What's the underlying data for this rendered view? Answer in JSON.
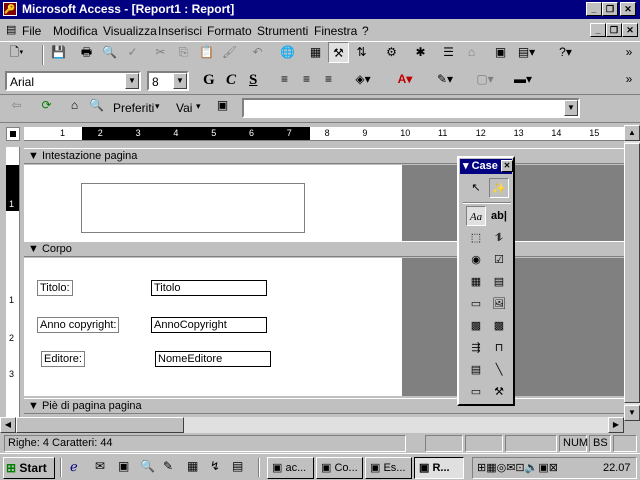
{
  "window": {
    "title": "Microsoft Access - [Report1 : Report]"
  },
  "menu": [
    "File",
    "Modifica",
    "Visualizza",
    "Inserisci",
    "Formato",
    "Strumenti",
    "Finestra",
    "?"
  ],
  "format": {
    "font": "Arial",
    "size": "8",
    "bold": "G",
    "italic": "C",
    "underline": "S"
  },
  "web": {
    "favorites": "Preferiti",
    "go": "Vai",
    "address": ""
  },
  "report": {
    "header_section": "Intestazione pagina",
    "body_section": "Corpo",
    "footer_section": "Piè di pagina pagina",
    "labels": [
      "Titolo:",
      "Anno copyright:",
      "Editore:"
    ],
    "fields": [
      "Titolo",
      "AnnoCopyright",
      "NomeEditore"
    ]
  },
  "ruler": {
    "marks": [
      "1",
      "2",
      "3",
      "4",
      "5",
      "6",
      "7",
      "8",
      "9",
      "10",
      "11",
      "12",
      "13",
      "14",
      "15"
    ]
  },
  "vruler": {
    "marks": [
      "1",
      "2",
      "1",
      "2",
      "3"
    ]
  },
  "toolbox": {
    "title": "Case",
    "text_tool": "Aa",
    "textbox_tool": "ab|"
  },
  "status": {
    "text": "Righe: 4  Caratteri: 44",
    "num": "NUM",
    "bs": "BS"
  },
  "taskbar": {
    "start": "Start",
    "tasks": [
      "ac...",
      "Co...",
      "Es...",
      "R..."
    ],
    "clock": "22.07"
  }
}
